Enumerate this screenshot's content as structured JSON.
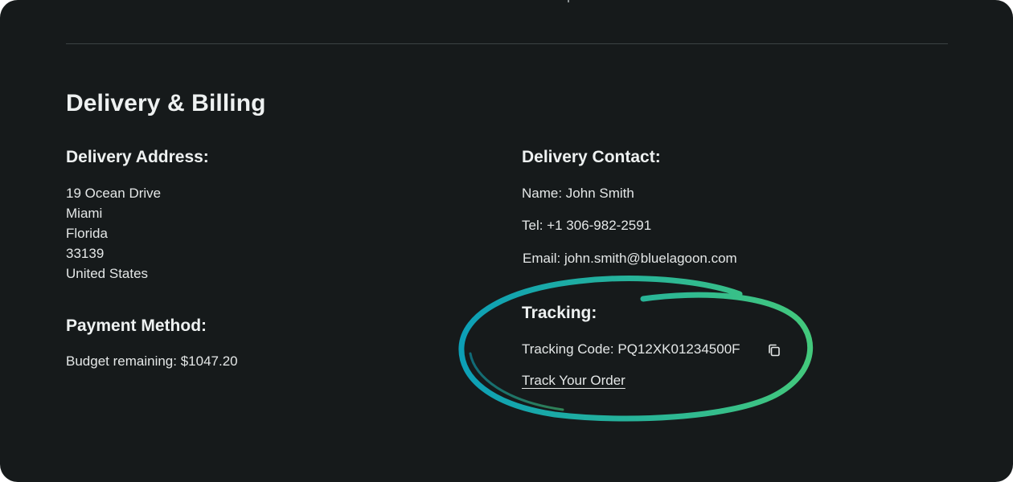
{
  "section": {
    "title": "Delivery & Billing"
  },
  "delivery_address": {
    "heading": "Delivery Address:",
    "lines": [
      "19 Ocean Drive",
      "Miami",
      "Florida",
      "33139",
      "United States"
    ]
  },
  "payment": {
    "heading": "Payment Method:",
    "budget": "Budget remaining: $1047.20"
  },
  "delivery_contact": {
    "heading": "Delivery Contact:",
    "name": "Name: John Smith",
    "tel": "Tel: +1 306-982-2591",
    "email": "Email: john.smith@bluelagoon.com"
  },
  "tracking": {
    "heading": "Tracking:",
    "code": "Tracking Code: PQ12XK01234500F",
    "copy_icon": "copy-icon",
    "link": "Track Your Order"
  },
  "colors": {
    "background": "#161a1b",
    "highlight_start": "#0c9fb6",
    "highlight_end": "#43c87c"
  }
}
